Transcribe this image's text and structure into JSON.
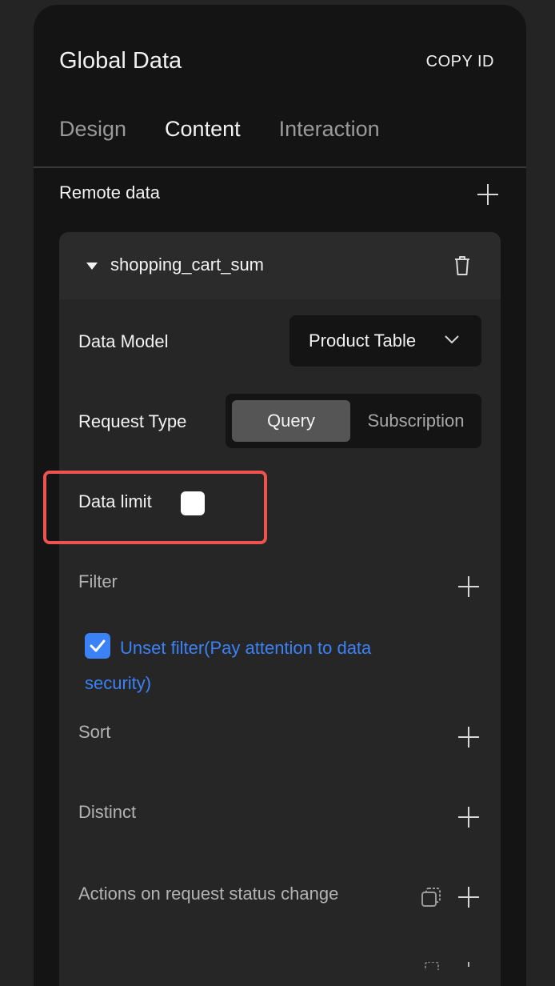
{
  "header": {
    "title": "Global Data",
    "copy_id_label": "COPY ID"
  },
  "tabs": [
    {
      "label": "Design",
      "active": false
    },
    {
      "label": "Content",
      "active": true
    },
    {
      "label": "Interaction",
      "active": false
    }
  ],
  "remote_data": {
    "section_label": "Remote data",
    "card": {
      "name": "shopping_cart_sum",
      "data_model": {
        "label": "Data Model",
        "value": "Product Table"
      },
      "request_type": {
        "label": "Request Type",
        "options": [
          "Query",
          "Subscription"
        ],
        "selected": "Query"
      },
      "data_limit": {
        "label": "Data limit",
        "checked": false
      },
      "filter": {
        "label": "Filter",
        "unset_filter_label": "Unset filter(Pay attention to data security)",
        "unset_checked": true
      },
      "sort": {
        "label": "Sort"
      },
      "distinct": {
        "label": "Distinct"
      },
      "actions": {
        "label": "Actions on request status change"
      }
    }
  },
  "colors": {
    "accent": "#3b82f6",
    "highlight": "#ef5350",
    "panel": "#141414",
    "card": "#262626"
  }
}
